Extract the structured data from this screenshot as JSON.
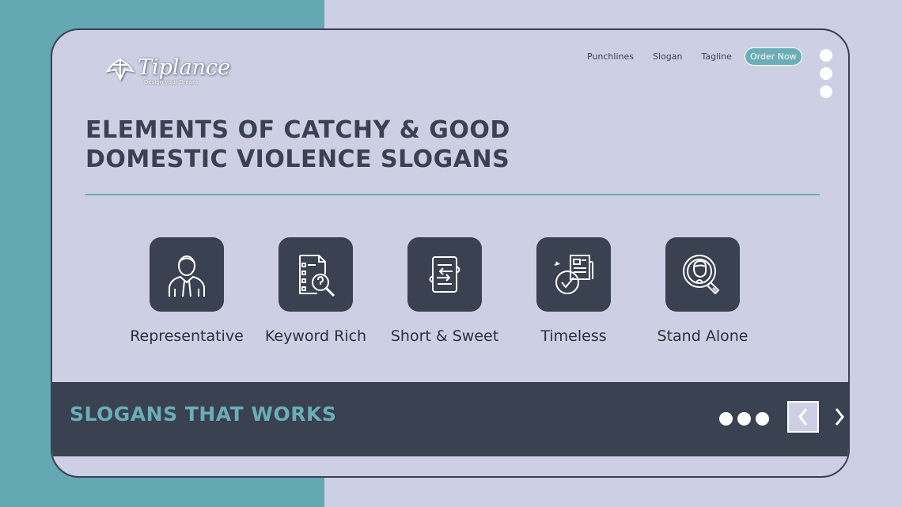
{
  "brand": {
    "name": "Tiplance",
    "tagline": "Design your Dream"
  },
  "nav": {
    "links": [
      "Punchlines",
      "Slogan",
      "Tagline"
    ],
    "cta": "Order Now"
  },
  "hero": {
    "title_line1": "Elements of Catchy & Good",
    "title_line2": "Domestic Violence Slogans"
  },
  "features": [
    {
      "label": "Representative",
      "icon": "person-icon"
    },
    {
      "label": "Keyword Rich",
      "icon": "document-search-icon"
    },
    {
      "label": "Short & Sweet",
      "icon": "exchange-document-icon"
    },
    {
      "label": "Timeless",
      "icon": "clock-news-icon"
    },
    {
      "label": "Stand Alone",
      "icon": "magnifier-person-icon"
    }
  ],
  "band": {
    "title": "Slogans That Works"
  },
  "colors": {
    "dark": "#3a4150",
    "accent": "#6aaeb8",
    "background": "#cdd0e5",
    "teal_panel": "#64a8b3"
  }
}
